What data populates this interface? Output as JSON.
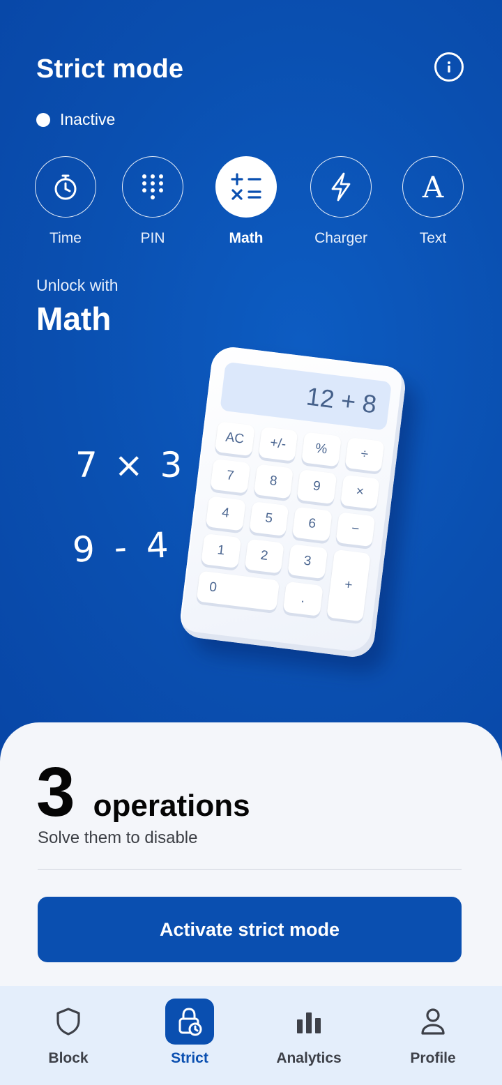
{
  "header": {
    "title": "Strict mode",
    "info_icon": "info-icon"
  },
  "status": {
    "label": "Inactive"
  },
  "methods": [
    {
      "label": "Time",
      "icon": "stopwatch-icon",
      "selected": false
    },
    {
      "label": "PIN",
      "icon": "keypad-icon",
      "selected": false
    },
    {
      "label": "Math",
      "icon": "math-operators-icon",
      "selected": true
    },
    {
      "label": "Charger",
      "icon": "lightning-icon",
      "selected": false
    },
    {
      "label": "Text",
      "icon": "letter-a-icon",
      "selected": false
    }
  ],
  "unlock": {
    "subtitle": "Unlock with",
    "method": "Math"
  },
  "illustration": {
    "expr1": "7 × 3",
    "expr2": "9 - 4",
    "display": "12 + 8",
    "keys": [
      "AC",
      "+/-",
      "%",
      "÷",
      "7",
      "8",
      "9",
      "×",
      "4",
      "5",
      "6",
      "−",
      "1",
      "2",
      "3",
      "+",
      "0",
      "."
    ]
  },
  "sheet": {
    "count": "3",
    "unit": "operations",
    "subtitle": "Solve them to disable",
    "cta": "Activate strict mode"
  },
  "tabs": [
    {
      "label": "Block",
      "icon": "shield-icon",
      "active": false
    },
    {
      "label": "Strict",
      "icon": "lock-clock-icon",
      "active": true
    },
    {
      "label": "Analytics",
      "icon": "bar-chart-icon",
      "active": false
    },
    {
      "label": "Profile",
      "icon": "person-icon",
      "active": false
    }
  ],
  "colors": {
    "primary": "#0a4fb0",
    "sheet_bg": "#f4f6fa",
    "tabbar_bg": "#e4eefb"
  }
}
